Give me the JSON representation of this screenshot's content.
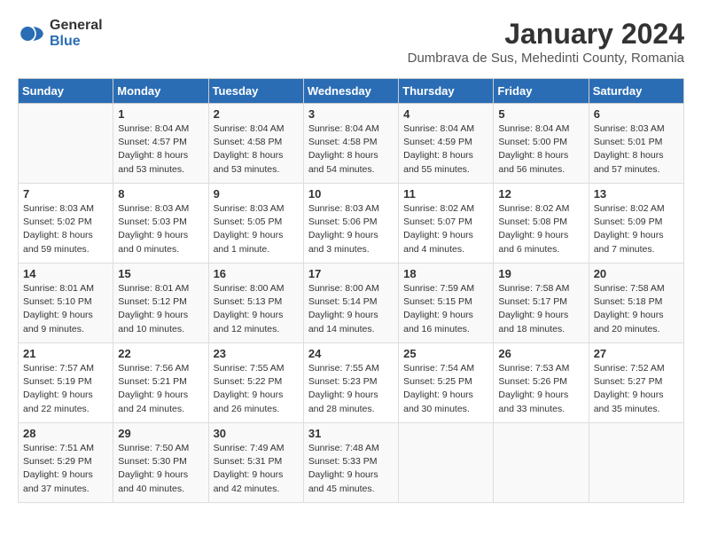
{
  "logo": {
    "line1": "General",
    "line2": "Blue"
  },
  "title": "January 2024",
  "location": "Dumbrava de Sus, Mehedinti County, Romania",
  "days_of_week": [
    "Sunday",
    "Monday",
    "Tuesday",
    "Wednesday",
    "Thursday",
    "Friday",
    "Saturday"
  ],
  "weeks": [
    [
      {
        "day": "",
        "sunrise": "",
        "sunset": "",
        "daylight": ""
      },
      {
        "day": "1",
        "sunrise": "Sunrise: 8:04 AM",
        "sunset": "Sunset: 4:57 PM",
        "daylight": "Daylight: 8 hours and 53 minutes."
      },
      {
        "day": "2",
        "sunrise": "Sunrise: 8:04 AM",
        "sunset": "Sunset: 4:58 PM",
        "daylight": "Daylight: 8 hours and 53 minutes."
      },
      {
        "day": "3",
        "sunrise": "Sunrise: 8:04 AM",
        "sunset": "Sunset: 4:58 PM",
        "daylight": "Daylight: 8 hours and 54 minutes."
      },
      {
        "day": "4",
        "sunrise": "Sunrise: 8:04 AM",
        "sunset": "Sunset: 4:59 PM",
        "daylight": "Daylight: 8 hours and 55 minutes."
      },
      {
        "day": "5",
        "sunrise": "Sunrise: 8:04 AM",
        "sunset": "Sunset: 5:00 PM",
        "daylight": "Daylight: 8 hours and 56 minutes."
      },
      {
        "day": "6",
        "sunrise": "Sunrise: 8:03 AM",
        "sunset": "Sunset: 5:01 PM",
        "daylight": "Daylight: 8 hours and 57 minutes."
      }
    ],
    [
      {
        "day": "7",
        "sunrise": "Sunrise: 8:03 AM",
        "sunset": "Sunset: 5:02 PM",
        "daylight": "Daylight: 8 hours and 59 minutes."
      },
      {
        "day": "8",
        "sunrise": "Sunrise: 8:03 AM",
        "sunset": "Sunset: 5:03 PM",
        "daylight": "Daylight: 9 hours and 0 minutes."
      },
      {
        "day": "9",
        "sunrise": "Sunrise: 8:03 AM",
        "sunset": "Sunset: 5:05 PM",
        "daylight": "Daylight: 9 hours and 1 minute."
      },
      {
        "day": "10",
        "sunrise": "Sunrise: 8:03 AM",
        "sunset": "Sunset: 5:06 PM",
        "daylight": "Daylight: 9 hours and 3 minutes."
      },
      {
        "day": "11",
        "sunrise": "Sunrise: 8:02 AM",
        "sunset": "Sunset: 5:07 PM",
        "daylight": "Daylight: 9 hours and 4 minutes."
      },
      {
        "day": "12",
        "sunrise": "Sunrise: 8:02 AM",
        "sunset": "Sunset: 5:08 PM",
        "daylight": "Daylight: 9 hours and 6 minutes."
      },
      {
        "day": "13",
        "sunrise": "Sunrise: 8:02 AM",
        "sunset": "Sunset: 5:09 PM",
        "daylight": "Daylight: 9 hours and 7 minutes."
      }
    ],
    [
      {
        "day": "14",
        "sunrise": "Sunrise: 8:01 AM",
        "sunset": "Sunset: 5:10 PM",
        "daylight": "Daylight: 9 hours and 9 minutes."
      },
      {
        "day": "15",
        "sunrise": "Sunrise: 8:01 AM",
        "sunset": "Sunset: 5:12 PM",
        "daylight": "Daylight: 9 hours and 10 minutes."
      },
      {
        "day": "16",
        "sunrise": "Sunrise: 8:00 AM",
        "sunset": "Sunset: 5:13 PM",
        "daylight": "Daylight: 9 hours and 12 minutes."
      },
      {
        "day": "17",
        "sunrise": "Sunrise: 8:00 AM",
        "sunset": "Sunset: 5:14 PM",
        "daylight": "Daylight: 9 hours and 14 minutes."
      },
      {
        "day": "18",
        "sunrise": "Sunrise: 7:59 AM",
        "sunset": "Sunset: 5:15 PM",
        "daylight": "Daylight: 9 hours and 16 minutes."
      },
      {
        "day": "19",
        "sunrise": "Sunrise: 7:58 AM",
        "sunset": "Sunset: 5:17 PM",
        "daylight": "Daylight: 9 hours and 18 minutes."
      },
      {
        "day": "20",
        "sunrise": "Sunrise: 7:58 AM",
        "sunset": "Sunset: 5:18 PM",
        "daylight": "Daylight: 9 hours and 20 minutes."
      }
    ],
    [
      {
        "day": "21",
        "sunrise": "Sunrise: 7:57 AM",
        "sunset": "Sunset: 5:19 PM",
        "daylight": "Daylight: 9 hours and 22 minutes."
      },
      {
        "day": "22",
        "sunrise": "Sunrise: 7:56 AM",
        "sunset": "Sunset: 5:21 PM",
        "daylight": "Daylight: 9 hours and 24 minutes."
      },
      {
        "day": "23",
        "sunrise": "Sunrise: 7:55 AM",
        "sunset": "Sunset: 5:22 PM",
        "daylight": "Daylight: 9 hours and 26 minutes."
      },
      {
        "day": "24",
        "sunrise": "Sunrise: 7:55 AM",
        "sunset": "Sunset: 5:23 PM",
        "daylight": "Daylight: 9 hours and 28 minutes."
      },
      {
        "day": "25",
        "sunrise": "Sunrise: 7:54 AM",
        "sunset": "Sunset: 5:25 PM",
        "daylight": "Daylight: 9 hours and 30 minutes."
      },
      {
        "day": "26",
        "sunrise": "Sunrise: 7:53 AM",
        "sunset": "Sunset: 5:26 PM",
        "daylight": "Daylight: 9 hours and 33 minutes."
      },
      {
        "day": "27",
        "sunrise": "Sunrise: 7:52 AM",
        "sunset": "Sunset: 5:27 PM",
        "daylight": "Daylight: 9 hours and 35 minutes."
      }
    ],
    [
      {
        "day": "28",
        "sunrise": "Sunrise: 7:51 AM",
        "sunset": "Sunset: 5:29 PM",
        "daylight": "Daylight: 9 hours and 37 minutes."
      },
      {
        "day": "29",
        "sunrise": "Sunrise: 7:50 AM",
        "sunset": "Sunset: 5:30 PM",
        "daylight": "Daylight: 9 hours and 40 minutes."
      },
      {
        "day": "30",
        "sunrise": "Sunrise: 7:49 AM",
        "sunset": "Sunset: 5:31 PM",
        "daylight": "Daylight: 9 hours and 42 minutes."
      },
      {
        "day": "31",
        "sunrise": "Sunrise: 7:48 AM",
        "sunset": "Sunset: 5:33 PM",
        "daylight": "Daylight: 9 hours and 45 minutes."
      },
      {
        "day": "",
        "sunrise": "",
        "sunset": "",
        "daylight": ""
      },
      {
        "day": "",
        "sunrise": "",
        "sunset": "",
        "daylight": ""
      },
      {
        "day": "",
        "sunrise": "",
        "sunset": "",
        "daylight": ""
      }
    ]
  ]
}
